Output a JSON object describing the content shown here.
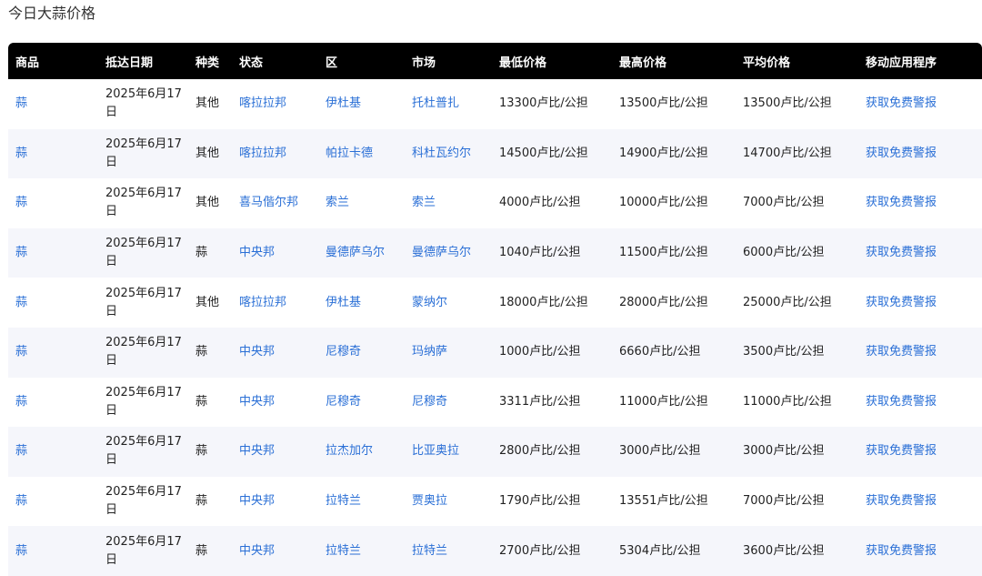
{
  "page": {
    "title": "今日大蒜价格"
  },
  "table": {
    "headers": [
      "商品",
      "抵达日期",
      "种类",
      "状态",
      "区",
      "市场",
      "最低价格",
      "最高价格",
      "平均价格",
      "移动应用程序"
    ],
    "rows": [
      {
        "commodity": "蒜",
        "date": "2025年6月17日",
        "variety": "其他",
        "state": "喀拉拉邦",
        "district": "伊杜基",
        "market": "托杜普扎",
        "min": "13300卢比/公担",
        "max": "13500卢比/公担",
        "avg": "13500卢比/公担",
        "app": "获取免费警报"
      },
      {
        "commodity": "蒜",
        "date": "2025年6月17日",
        "variety": "其他",
        "state": "喀拉拉邦",
        "district": "帕拉卡德",
        "market": "科杜瓦约尔",
        "min": "14500卢比/公担",
        "max": "14900卢比/公担",
        "avg": "14700卢比/公担",
        "app": "获取免费警报"
      },
      {
        "commodity": "蒜",
        "date": "2025年6月17日",
        "variety": "其他",
        "state": "喜马偕尔邦",
        "district": "索兰",
        "market": "索兰",
        "min": "4000卢比/公担",
        "max": "10000卢比/公担",
        "avg": "7000卢比/公担",
        "app": "获取免费警报"
      },
      {
        "commodity": "蒜",
        "date": "2025年6月17日",
        "variety": "蒜",
        "state": "中央邦",
        "district": "曼德萨乌尔",
        "market": "曼德萨乌尔",
        "min": "1040卢比/公担",
        "max": "11500卢比/公担",
        "avg": "6000卢比/公担",
        "app": "获取免费警报"
      },
      {
        "commodity": "蒜",
        "date": "2025年6月17日",
        "variety": "其他",
        "state": "喀拉拉邦",
        "district": "伊杜基",
        "market": "蒙纳尔",
        "min": "18000卢比/公担",
        "max": "28000卢比/公担",
        "avg": "25000卢比/公担",
        "app": "获取免费警报"
      },
      {
        "commodity": "蒜",
        "date": "2025年6月17日",
        "variety": "蒜",
        "state": "中央邦",
        "district": "尼穆奇",
        "market": "玛纳萨",
        "min": "1000卢比/公担",
        "max": "6660卢比/公担",
        "avg": "3500卢比/公担",
        "app": "获取免费警报"
      },
      {
        "commodity": "蒜",
        "date": "2025年6月17日",
        "variety": "蒜",
        "state": "中央邦",
        "district": "尼穆奇",
        "market": "尼穆奇",
        "min": "3311卢比/公担",
        "max": "11000卢比/公担",
        "avg": "11000卢比/公担",
        "app": "获取免费警报"
      },
      {
        "commodity": "蒜",
        "date": "2025年6月17日",
        "variety": "蒜",
        "state": "中央邦",
        "district": "拉杰加尔",
        "market": "比亚奥拉",
        "min": "2800卢比/公担",
        "max": "3000卢比/公担",
        "avg": "3000卢比/公担",
        "app": "获取免费警报"
      },
      {
        "commodity": "蒜",
        "date": "2025年6月17日",
        "variety": "蒜",
        "state": "中央邦",
        "district": "拉特兰",
        "market": "贾奥拉",
        "min": "1790卢比/公担",
        "max": "13551卢比/公担",
        "avg": "7000卢比/公担",
        "app": "获取免费警报"
      },
      {
        "commodity": "蒜",
        "date": "2025年6月17日",
        "variety": "蒜",
        "state": "中央邦",
        "district": "拉特兰",
        "market": "拉特兰",
        "min": "2700卢比/公担",
        "max": "5304卢比/公担",
        "avg": "3600卢比/公担",
        "app": "获取免费警报"
      }
    ]
  },
  "colors": {
    "header_bg": "#000000",
    "link": "#2a6fd6",
    "stripe": "#f5f6fb"
  }
}
